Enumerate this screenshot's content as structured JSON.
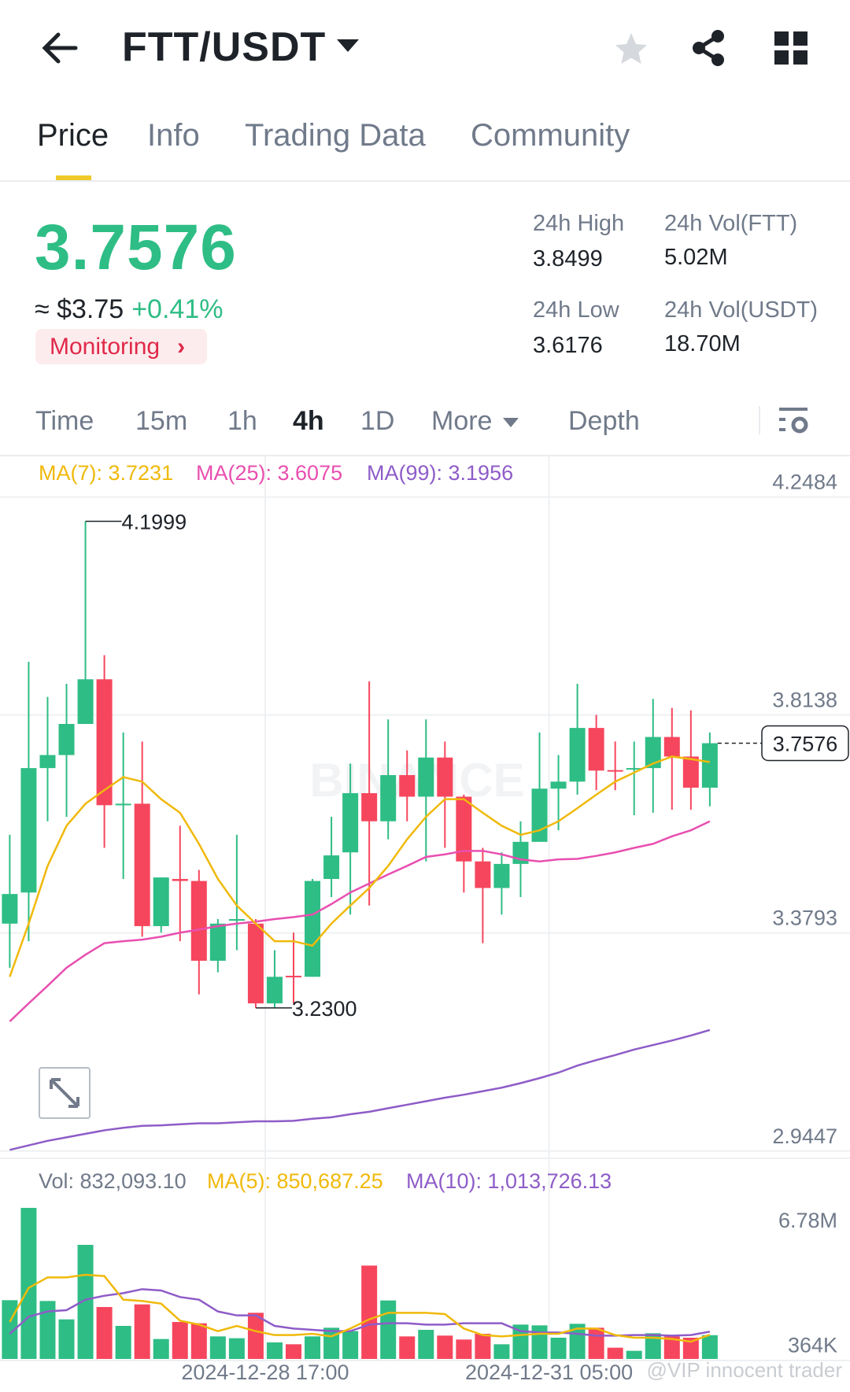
{
  "header": {
    "title": "FTT/USDT",
    "icons": [
      "back-arrow-icon",
      "dropdown-caret-icon",
      "star-icon",
      "share-icon",
      "grid-icon"
    ]
  },
  "tabs": [
    {
      "label": "Price",
      "active": true
    },
    {
      "label": "Info"
    },
    {
      "label": "Trading Data"
    },
    {
      "label": "Community"
    }
  ],
  "ticker": {
    "last_price": "3.7576",
    "fiat": "≈ $3.75",
    "change": "+0.41%",
    "monitoring": "Monitoring",
    "high_label": "24h High",
    "high": "3.8499",
    "low_label": "24h Low",
    "low": "3.6176",
    "vol_base_label": "24h Vol(FTT)",
    "vol_base": "5.02M",
    "vol_quote_label": "24h Vol(USDT)",
    "vol_quote": "18.70M"
  },
  "intervals": [
    {
      "label": "Time"
    },
    {
      "label": "15m"
    },
    {
      "label": "1h"
    },
    {
      "label": "4h",
      "active": true
    },
    {
      "label": "1D"
    },
    {
      "label": "More"
    },
    {
      "label": "Depth"
    }
  ],
  "colors": {
    "up": "#2ebd85",
    "down": "#f6465d",
    "ma7": "#f0b90b",
    "ma25": "#e84fb0",
    "ma99": "#8e5cc8",
    "vma5": "#f0b90b",
    "vma10": "#8e5cc8"
  },
  "chart_data": {
    "type": "candlestick",
    "legend": {
      "ma7": "MA(7): 3.7231",
      "ma25": "MA(25): 3.6075",
      "ma99": "MA(99): 3.1956"
    },
    "y_ticks": [
      "4.2484",
      "3.8138",
      "3.3793",
      "2.9447"
    ],
    "y_tick_values": [
      4.2484,
      3.8138,
      3.3793,
      2.9447
    ],
    "x_ticks": [
      "2024-12-28 17:00",
      "2024-12-31 05:00"
    ],
    "x_tick_index": [
      14,
      29
    ],
    "high_marker": "4.1999",
    "high_index": 5,
    "low_marker": "3.2300",
    "low_index": 14,
    "last_price_label": "3.7576",
    "candles": [
      [
        3.398,
        3.575,
        3.31,
        3.457
      ],
      [
        3.46,
        3.92,
        3.363,
        3.708
      ],
      [
        3.708,
        3.85,
        3.602,
        3.734
      ],
      [
        3.734,
        3.876,
        3.611,
        3.796
      ],
      [
        3.796,
        4.1999,
        3.796,
        3.885
      ],
      [
        3.885,
        3.933,
        3.549,
        3.634
      ],
      [
        3.634,
        3.779,
        3.487,
        3.637
      ],
      [
        3.637,
        3.761,
        3.372,
        3.393
      ],
      [
        3.393,
        3.49,
        3.38,
        3.49
      ],
      [
        3.487,
        3.593,
        3.363,
        3.483
      ],
      [
        3.483,
        3.505,
        3.257,
        3.324
      ],
      [
        3.324,
        3.407,
        3.301,
        3.398
      ],
      [
        3.405,
        3.575,
        3.345,
        3.407
      ],
      [
        3.398,
        3.407,
        3.23,
        3.239
      ],
      [
        3.239,
        3.345,
        3.23,
        3.292
      ],
      [
        3.294,
        3.38,
        3.239,
        3.292
      ],
      [
        3.292,
        3.487,
        3.292,
        3.483
      ],
      [
        3.487,
        3.611,
        3.451,
        3.534
      ],
      [
        3.54,
        3.717,
        3.416,
        3.658
      ],
      [
        3.658,
        3.881,
        3.434,
        3.602
      ],
      [
        3.602,
        3.805,
        3.566,
        3.694
      ],
      [
        3.694,
        3.743,
        3.602,
        3.651
      ],
      [
        3.651,
        3.805,
        3.522,
        3.729
      ],
      [
        3.729,
        3.761,
        3.549,
        3.651
      ],
      [
        3.651,
        3.655,
        3.46,
        3.522
      ],
      [
        3.522,
        3.549,
        3.359,
        3.469
      ],
      [
        3.469,
        3.54,
        3.416,
        3.517
      ],
      [
        3.517,
        3.602,
        3.451,
        3.561
      ],
      [
        3.561,
        3.779,
        3.566,
        3.667
      ],
      [
        3.667,
        3.734,
        3.584,
        3.681
      ],
      [
        3.681,
        3.876,
        3.655,
        3.788
      ],
      [
        3.788,
        3.814,
        3.664,
        3.703
      ],
      [
        3.704,
        3.761,
        3.664,
        3.703
      ],
      [
        3.706,
        3.761,
        3.614,
        3.708
      ],
      [
        3.708,
        3.846,
        3.619,
        3.77
      ],
      [
        3.77,
        3.828,
        3.625,
        3.731
      ],
      [
        3.731,
        3.823,
        3.625,
        3.669
      ],
      [
        3.669,
        3.779,
        3.632,
        3.7576
      ]
    ],
    "ma7": [
      3.292,
      3.398,
      3.513,
      3.593,
      3.637,
      3.664,
      3.69,
      3.681,
      3.646,
      3.619,
      3.557,
      3.487,
      3.434,
      3.398,
      3.363,
      3.363,
      3.354,
      3.398,
      3.434,
      3.469,
      3.513,
      3.566,
      3.611,
      3.646,
      3.646,
      3.619,
      3.593,
      3.575,
      3.584,
      3.602,
      3.628,
      3.655,
      3.681,
      3.699,
      3.717,
      3.731,
      3.726,
      3.72
    ],
    "ma25": [
      3.203,
      3.239,
      3.274,
      3.31,
      3.336,
      3.359,
      3.363,
      3.366,
      3.372,
      3.38,
      3.386,
      3.393,
      3.398,
      3.402,
      3.407,
      3.411,
      3.416,
      3.437,
      3.46,
      3.478,
      3.496,
      3.513,
      3.531,
      3.536,
      3.543,
      3.543,
      3.536,
      3.526,
      3.522,
      3.526,
      3.527,
      3.533,
      3.54,
      3.549,
      3.557,
      3.572,
      3.584,
      3.602
    ],
    "ma99": [
      2.947,
      2.956,
      2.965,
      2.972,
      2.979,
      2.986,
      2.991,
      2.995,
      2.996,
      2.998,
      3.0,
      3.0,
      3.002,
      3.004,
      3.004,
      3.005,
      3.009,
      3.012,
      3.018,
      3.023,
      3.03,
      3.037,
      3.044,
      3.051,
      3.057,
      3.064,
      3.071,
      3.08,
      3.09,
      3.101,
      3.115,
      3.126,
      3.136,
      3.147,
      3.156,
      3.165,
      3.175,
      3.186
    ],
    "volume": {
      "legend": {
        "vol": "Vol: 832,093.10",
        "ma5": "MA(5): 850,687.25",
        "ma10": "MA(10): 1,013,726.13"
      },
      "y_ticks": [
        "6.78M",
        "364K"
      ],
      "y_tick_values": [
        6.78,
        0.364
      ],
      "unit": "M",
      "values": [
        2.634,
        7.389,
        2.593,
        1.647,
        5.484,
        2.282,
        1.31,
        2.418,
        0.634,
        1.512,
        1.445,
        0.769,
        0.675,
        1.985,
        0.459,
        0.364,
        0.769,
        1.215,
        1.04,
        4.417,
        2.62,
        0.769,
        1.107,
        0.81,
        0.607,
        0.904,
        0.364,
        1.377,
        1.337,
        0.702,
        1.418,
        1.215,
        0.188,
        0.026,
        0.931,
        0.769,
        0.702,
        0.832
      ],
      "ma5": [
        1.512,
        3.269,
        3.809,
        3.809,
        3.944,
        3.877,
        2.661,
        2.593,
        2.458,
        1.58,
        1.377,
        1.04,
        1.31,
        1.04,
        0.837,
        0.837,
        0.904,
        0.769,
        1.175,
        1.647,
        1.985,
        1.985,
        1.985,
        1.918,
        1.175,
        0.837,
        0.769,
        0.837,
        0.904,
        0.904,
        1.175,
        1.175,
        0.837,
        0.702,
        0.702,
        0.634,
        0.499,
        0.851
      ],
      "ma10": [
        0.904,
        1.783,
        2.053,
        2.12,
        2.661,
        2.863,
        2.998,
        3.201,
        3.134,
        2.796,
        2.661,
        2.053,
        1.85,
        1.85,
        1.31,
        1.175,
        1.107,
        1.04,
        1.04,
        1.377,
        1.445,
        1.445,
        1.377,
        1.377,
        1.445,
        1.445,
        1.445,
        1.04,
        0.972,
        0.972,
        0.904,
        0.81,
        0.81,
        0.837,
        0.837,
        0.81,
        0.837,
        1.014
      ]
    }
  },
  "watermark": "@VIP innocent trader",
  "brand_watermark": "BINANCE"
}
